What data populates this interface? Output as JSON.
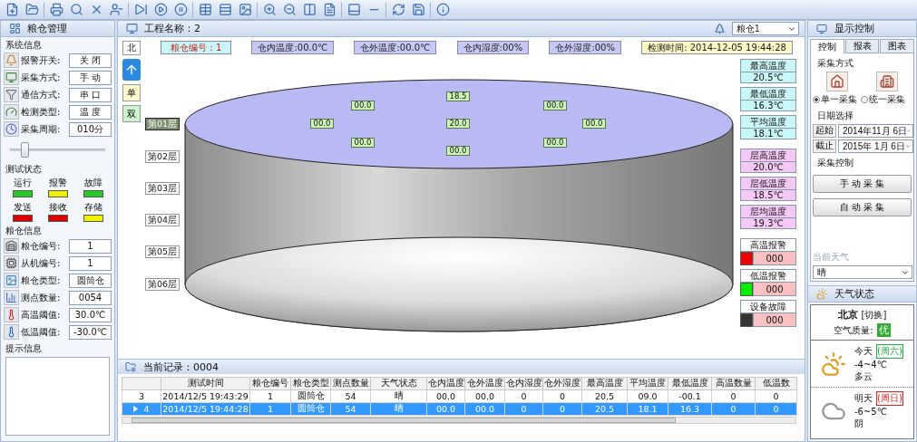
{
  "left_panel": {
    "title": "粮仓管理",
    "system_info": {
      "title": "系统信息",
      "rows": [
        {
          "label": "报警开关:",
          "value": "关 闭"
        },
        {
          "label": "采集方式:",
          "value": "手 动"
        },
        {
          "label": "通信方式:",
          "value": "串 口"
        },
        {
          "label": "检测类型:",
          "value": "温 度"
        },
        {
          "label": "采集周期:",
          "value": "010分"
        }
      ]
    },
    "slider": {
      "level": 0.15
    },
    "test_status": {
      "title": "测试状态",
      "indicators": [
        {
          "label": "运行",
          "color": "#22cc22"
        },
        {
          "label": "报警",
          "color": "#f0f000"
        },
        {
          "label": "故障",
          "color": "#22cc22"
        },
        {
          "label": "发送",
          "color": "#dd0000"
        },
        {
          "label": "接收",
          "color": "#dd0000"
        },
        {
          "label": "存储",
          "color": "#f0f000"
        }
      ]
    },
    "granary_info": {
      "title": "粮仓信息",
      "rows": [
        {
          "label": "粮仓编号:",
          "value": "1"
        },
        {
          "label": "从机编号:",
          "value": "1"
        },
        {
          "label": "粮仓类型:",
          "value": "圆筒仓"
        },
        {
          "label": "测点数量:",
          "value": "0054"
        },
        {
          "label": "高温阈值:",
          "value": "30.0℃"
        },
        {
          "label": "低温阈值:",
          "value": "-30.0℃"
        }
      ]
    },
    "hint": {
      "title": "提示信息"
    }
  },
  "main": {
    "title": "工程名称：2",
    "granary_select": "粮仓1",
    "north": "北",
    "info": [
      {
        "kind": "id",
        "text": "粮仓编号：1"
      },
      {
        "kind": "reading",
        "text": "仓内温度:00.0℃"
      },
      {
        "kind": "reading",
        "text": "仓外温度:00.0℃"
      },
      {
        "kind": "reading",
        "text": "仓内湿度:00%"
      },
      {
        "kind": "reading",
        "text": "仓外湿度:00%"
      },
      {
        "kind": "time",
        "text": "检测时间: 2014-12-05 19:44:28"
      }
    ],
    "view_buttons": [
      {
        "label": "单",
        "color": "#fffacc"
      },
      {
        "label": "双",
        "color": "#ccf5cc"
      }
    ],
    "sensors": [
      "18.5",
      "00.0",
      "00.0",
      "00.0",
      "20.0",
      "00.0",
      "00.0",
      "00.0",
      "00.0"
    ],
    "layers": [
      {
        "label": "第01层",
        "selected": true
      },
      {
        "label": "第02层",
        "selected": false
      },
      {
        "label": "第03层",
        "selected": false
      },
      {
        "label": "第04层",
        "selected": false
      },
      {
        "label": "第05层",
        "selected": false
      },
      {
        "label": "第06层",
        "selected": false
      }
    ],
    "stats": [
      {
        "kind": "overall",
        "label": "最高温度",
        "value": "20.5℃"
      },
      {
        "kind": "overall",
        "label": "最低温度",
        "value": "16.3℃"
      },
      {
        "kind": "overall",
        "label": "平均温度",
        "value": "18.1℃"
      },
      {
        "kind": "layer",
        "label": "层高温度",
        "value": "20.0℃"
      },
      {
        "kind": "layer",
        "label": "层低温度",
        "value": "18.5℃"
      },
      {
        "kind": "layer",
        "label": "层均温度",
        "value": "19.3℃"
      },
      {
        "kind": "alarm",
        "label": "高温报警",
        "value": "000",
        "color": "#ee0000"
      },
      {
        "kind": "alarm",
        "label": "低温报警",
        "value": "000",
        "color": "#00ee00"
      },
      {
        "kind": "alarm",
        "label": "设备故障",
        "value": "000",
        "color": "#333333"
      }
    ]
  },
  "table": {
    "title": "当前记录：0004",
    "columns": [
      "",
      "测试时间",
      "粮仓编号",
      "粮仓类型",
      "测点数量",
      "天气状态",
      "仓内温度",
      "仓外温度",
      "仓内湿度",
      "仓外湿度",
      "最高温度",
      "平均温度",
      "最低温度",
      "高温数量",
      "低温数"
    ],
    "rows": [
      {
        "selected": false,
        "cells": [
          "3",
          "2014/12/5 19:43:29",
          "1",
          "圆筒仓",
          "54",
          "晴",
          "00.0",
          "00.0",
          "0",
          "0",
          "20.5",
          "09.0",
          "-00.1",
          "0",
          "0"
        ]
      },
      {
        "selected": true,
        "cells": [
          "4",
          "2014/12/5 19:44:28",
          "1",
          "圆筒仓",
          "54",
          "晴",
          "00.0",
          "00.0",
          "0",
          "0",
          "20.5",
          "18.1",
          "16.3",
          "0",
          "0"
        ]
      }
    ]
  },
  "right_panel": {
    "title": "显示控制",
    "tabs": [
      {
        "label": "控制",
        "selected": true
      },
      {
        "label": "报表",
        "selected": false
      },
      {
        "label": "图表",
        "selected": false
      }
    ],
    "collect_mode": {
      "title": "采集方式",
      "options": [
        {
          "label": "单一采集",
          "selected": true
        },
        {
          "label": "统一采集",
          "selected": false
        }
      ]
    },
    "date": {
      "title": "日期选择",
      "rows": [
        {
          "label": "起始",
          "value": "2014年11月 6日"
        },
        {
          "label": "截止",
          "value": "2015年 1月 6日"
        }
      ]
    },
    "control": {
      "title": "采集控制",
      "buttons": [
        "手 动 采 集",
        "自 动 采 集"
      ]
    },
    "weather_select": {
      "legend": "当前天气",
      "value": "晴"
    }
  },
  "weather": {
    "title": "天气状态",
    "city": "北京",
    "switch": "[切换]",
    "aqi_label": "空气质量:",
    "aqi": "优",
    "days": [
      {
        "kind": "partly_cloudy",
        "name": "今天",
        "weekday": "(周六)",
        "color": "#22aa44",
        "temp": "-4~4℃",
        "desc": "多云"
      },
      {
        "kind": "overcast",
        "name": "明天",
        "weekday": "(周日)",
        "color": "#dd2222",
        "temp": "-6~5℃",
        "desc": "阴"
      }
    ]
  }
}
